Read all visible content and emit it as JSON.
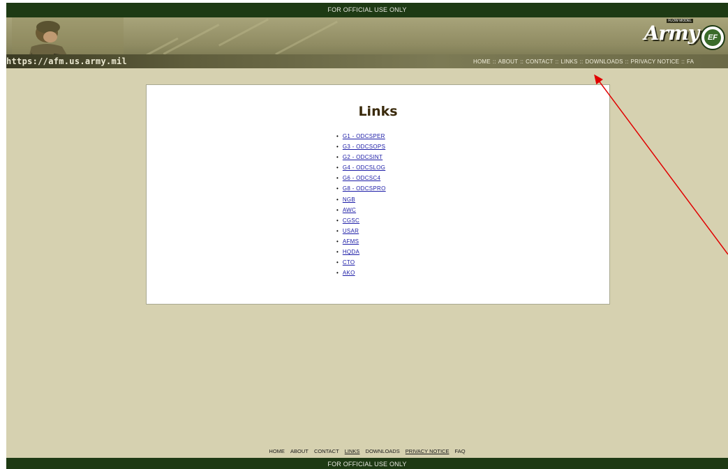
{
  "top_banner_text": "FOR OFFICIAL USE ONLY",
  "bottom_banner_text": "FOR OFFICIAL USE ONLY",
  "site_url": "https://afm.us.army.mil",
  "logo": {
    "text": "Army",
    "tagline": "FLOW MODEL",
    "badge": "EF"
  },
  "top_nav": {
    "items": [
      {
        "label": "HOME",
        "underlined": false
      },
      {
        "label": "ABOUT",
        "underlined": true
      },
      {
        "label": "CONTACT",
        "underlined": true
      },
      {
        "label": "LINKS",
        "underlined": false
      },
      {
        "label": "DOWNLOADS",
        "underlined": false
      },
      {
        "label": "PRIVACY NOTICE",
        "underlined": true
      },
      {
        "label": "FA",
        "underlined": false
      }
    ],
    "separator": "::"
  },
  "main": {
    "title": "Links",
    "links": [
      "G1 - ODCSPER",
      "G3 - ODCSOPS",
      "G2 - ODCSINT",
      "G4 - ODCSLOG",
      "G6 - ODCSC4",
      "G8 - ODCSPRO",
      "NGB",
      "AWC",
      "CGSC",
      "USAR",
      "AFMS",
      "HQDA",
      "CTO",
      "AKO"
    ]
  },
  "footer_nav": {
    "items": [
      {
        "label": "HOME",
        "underlined": false
      },
      {
        "label": "ABOUT",
        "underlined": false
      },
      {
        "label": "CONTACT",
        "underlined": false
      },
      {
        "label": "LINKS",
        "underlined": true
      },
      {
        "label": "DOWNLOADS",
        "underlined": false
      },
      {
        "label": "PRIVACY NOTICE",
        "underlined": true
      },
      {
        "label": "FAQ",
        "underlined": false
      }
    ]
  },
  "colors": {
    "page_bg": "#d6d1b0",
    "banner_bar": "#1e3a14",
    "link": "#1a1aa6",
    "annotation_arrow": "#e00000"
  }
}
